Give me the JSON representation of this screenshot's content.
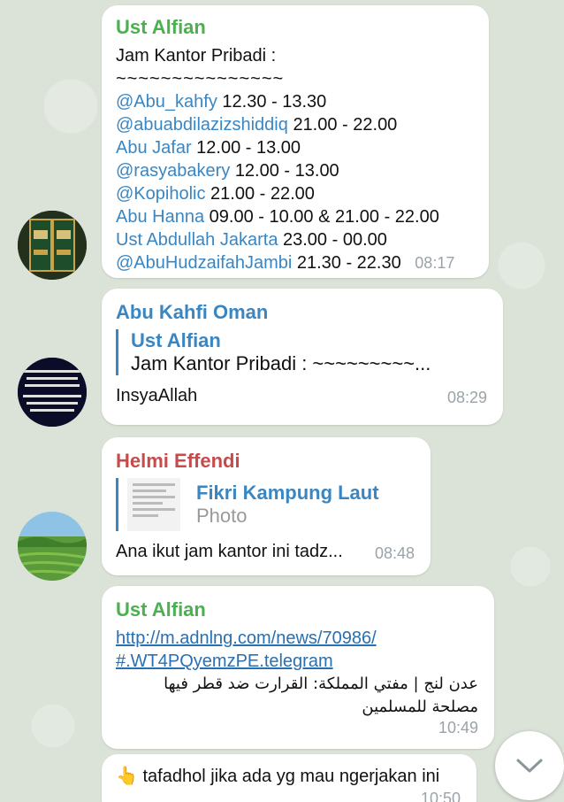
{
  "colors": {
    "sender_green": "#4caf50",
    "sender_blue": "#3a86c2",
    "sender_red": "#c84b4b",
    "link": "#2a6fb0"
  },
  "messages": [
    {
      "sender": "Ust Alfian",
      "title": "Jam Kantor Pribadi :",
      "tilde": "~~~~~~~~~~~~~~~",
      "rows": [
        {
          "name": "@Abu_kahfy",
          "time": "12.30 - 13.30"
        },
        {
          "name": "@abuabdilazizshiddiq",
          "time": "21.00 - 22.00"
        },
        {
          "name": "Abu Jafar",
          "time": "12.00 - 13.00"
        },
        {
          "name": "@rasyabakery",
          "time": "12.00 - 13.00"
        },
        {
          "name": "@Kopiholic",
          "time": "21.00 - 22.00"
        },
        {
          "name": "Abu Hanna",
          "time": "09.00 - 10.00 & 21.00 - 22.00"
        },
        {
          "name": "Ust Abdullah Jakarta",
          "time": "23.00 - 00.00"
        },
        {
          "name": "@AbuHudzaifahJambi",
          "time": "21.30 - 22.30"
        }
      ],
      "timestamp": "08:17"
    },
    {
      "sender": "Abu Kahfi Oman",
      "reply_name": "Ust Alfian",
      "reply_text": "Jam Kantor Pribadi : ~~~~~~~~~...",
      "text": "InsyaAllah",
      "timestamp": "08:29"
    },
    {
      "sender": "Helmi Effendi",
      "reply_name": "Fikri Kampung Laut",
      "reply_text": "Photo",
      "text": "Ana ikut jam kantor ini tadz...",
      "timestamp": "08:48"
    },
    {
      "sender": "Ust Alfian",
      "link_line1": "http://m.adnlng.com/news/70986/",
      "link_line2": "#.WT4PQyemzPE.telegram",
      "arabic_line1": "عدن لنج | مفتي المملكة: القرارت ضد قطر فيها",
      "arabic_line2": "مصلحة للمسلمين",
      "timestamp": "10:49"
    },
    {
      "emoji": "👆",
      "text": "tafadhol jika ada yg mau ngerjakan ini",
      "timestamp": "10:50"
    }
  ],
  "avatar_texts": {
    "book_top": "كتاب",
    "book_bottom": "عقيدة",
    "quote": "وما لا يقبل من الإنسان ولا يقتص من الظلم... فالحق على ذلك ... والعقول"
  }
}
